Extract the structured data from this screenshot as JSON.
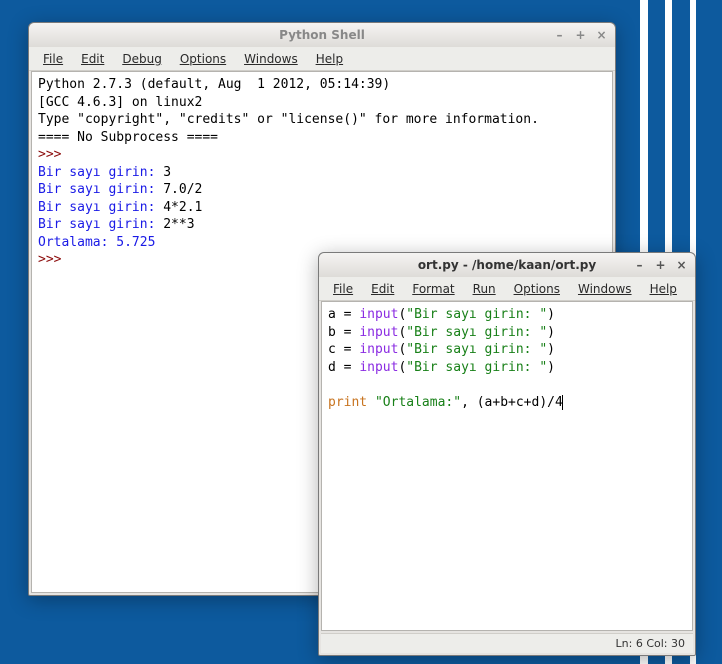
{
  "shell": {
    "title": "Python Shell",
    "menu": [
      "File",
      "Edit",
      "Debug",
      "Options",
      "Windows",
      "Help"
    ],
    "header": [
      "Python 2.7.3 (default, Aug  1 2012, 05:14:39) ",
      "[GCC 4.6.3] on linux2",
      "Type \"copyright\", \"credits\" or \"license()\" for more information.",
      "==== No Subprocess ===="
    ],
    "lines": [
      {
        "prompt": ">>>",
        "rest": " "
      },
      {
        "blue": "Bir sayı girin: ",
        "black": "3"
      },
      {
        "blue": "Bir sayı girin: ",
        "black": "7.0/2"
      },
      {
        "blue": "Bir sayı girin: ",
        "black": "4*2.1"
      },
      {
        "blue": "Bir sayı girin: ",
        "black": "2**3"
      },
      {
        "blue": "Ortalama: 5.725"
      },
      {
        "prompt": ">>>",
        "rest": " "
      }
    ]
  },
  "editor": {
    "title": "ort.py - /home/kaan/ort.py",
    "menu": [
      "File",
      "Edit",
      "Format",
      "Run",
      "Options",
      "Windows",
      "Help"
    ],
    "code": {
      "assigns": [
        {
          "var": "a"
        },
        {
          "var": "b"
        },
        {
          "var": "c"
        },
        {
          "var": "d"
        }
      ],
      "input_str": "\"Bir sayı girin: \"",
      "blank": "",
      "print_kw": "print",
      "print_str": "\"Ortalama:\"",
      "print_tail": ", (a+b+c+d)/4"
    },
    "status": "Ln: 6 Col: 30"
  },
  "winbtn": {
    "min": "–",
    "max": "+",
    "close": "×"
  }
}
